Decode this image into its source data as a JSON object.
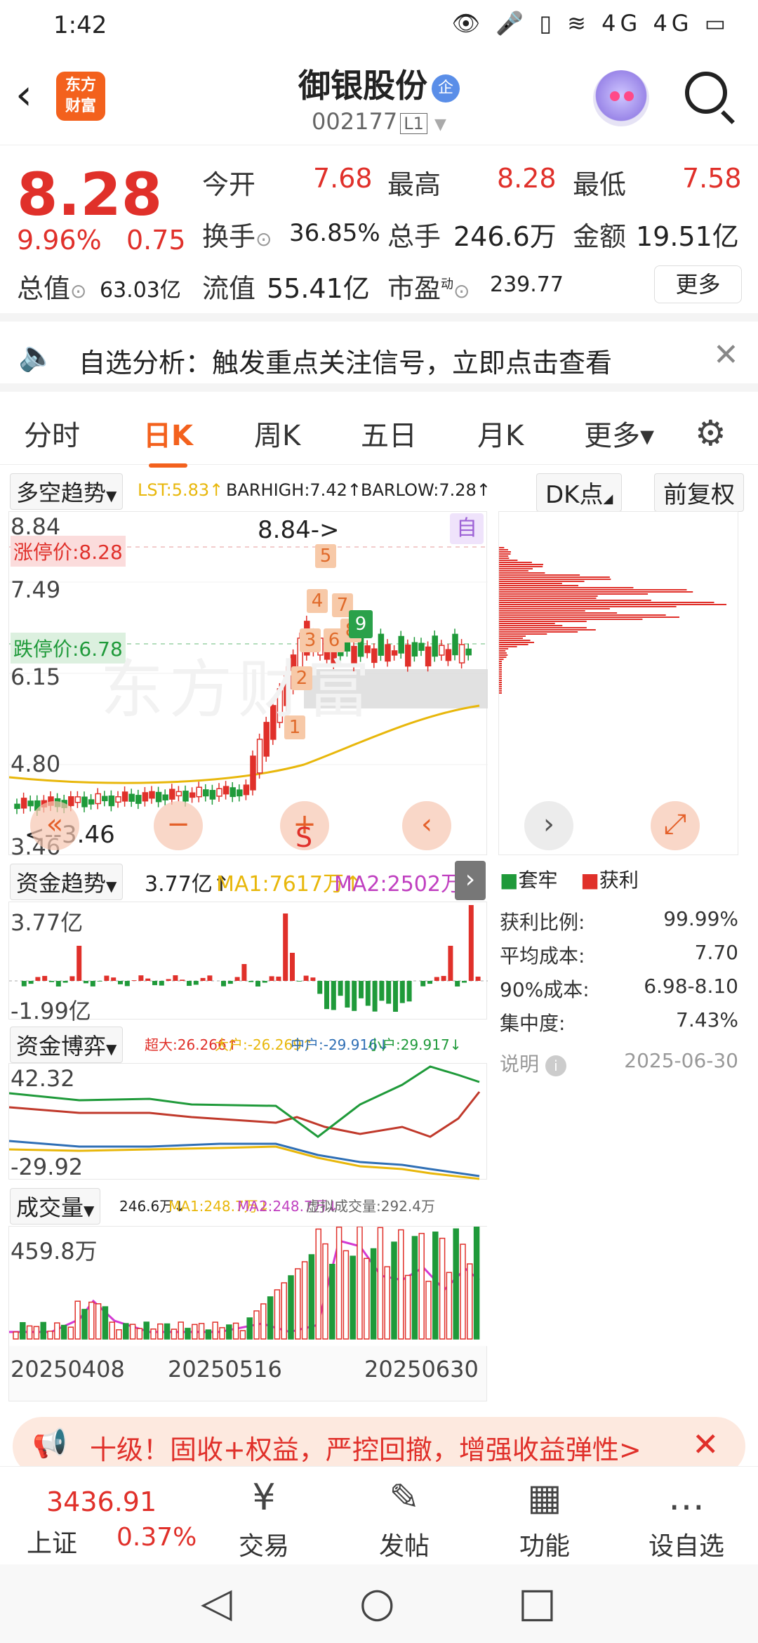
{
  "status_bar": {
    "time": "1:42",
    "icons": "👁 🎤 ▯ ≋ 4G 4G ▭"
  },
  "header": {
    "title": "御银股份",
    "qi_badge": "企",
    "code": "002177",
    "code_badge": "L1",
    "logo_text_1": "东方",
    "logo_text_2": "财富"
  },
  "quote": {
    "price": "8.28",
    "change_pct": "9.96%",
    "change_val": "0.75",
    "open_label": "今开",
    "open": "7.68",
    "high_label": "最高",
    "high": "8.28",
    "low_label": "最低",
    "low": "7.58",
    "turnover_label": "换手",
    "turnover": "36.85%",
    "volume_label": "总手",
    "volume": "246.6万",
    "amount_label": "金额",
    "amount": "19.51亿",
    "mcap_label": "总值",
    "mcap": "63.03亿",
    "float_label": "流值",
    "float": "55.41亿",
    "pe_label": "市盈",
    "pe_sup": "动",
    "pe": "239.77",
    "more": "更多"
  },
  "notice": {
    "text": "自选分析：触发重点关注信号，立即点击查看"
  },
  "tabs": [
    "分时",
    "日K",
    "周K",
    "五日",
    "月K",
    "更多▾"
  ],
  "kline": {
    "indicator": "多空趋势",
    "lst": "LST:5.83↑",
    "barhigh": "BARHIGH:7.42↑",
    "barlow": "BARLOW:7.28↑",
    "dk_btn": "DK点",
    "fq_btn": "前复权",
    "ticks": [
      "8.84",
      "7.49",
      "6.15",
      "4.80",
      "3.46"
    ],
    "limit_up": "涨停价:8.28",
    "limit_down": "跌停价:6.78",
    "high_mark": "8.84->",
    "low_mark": "<--3.46",
    "self_badge": "自",
    "watermark": "东方财富",
    "chips": [
      "1",
      "2",
      "3",
      "4",
      "5",
      "6",
      "7",
      "8",
      "9"
    ],
    "s_mark": "S"
  },
  "chip_dist": {
    "legend_trapped": "套牢",
    "legend_profit": "获利",
    "rows": [
      {
        "label": "获利比例:",
        "value": "99.99%"
      },
      {
        "label": "平均成本:",
        "value": "7.70"
      },
      {
        "label": "90%成本:",
        "value": "6.98-8.10"
      },
      {
        "label": "集中度:",
        "value": "7.43%"
      }
    ],
    "note": "说明",
    "date": "2025-06-30"
  },
  "fund_trend": {
    "indicator": "资金趋势",
    "val": "3.77亿↑",
    "ma1": "MA1:7617万↑",
    "ma2": "MA2:2502万↑",
    "top": "3.77亿",
    "bottom": "-1.99亿"
  },
  "fund_game": {
    "indicator": "资金博弈",
    "super": "超大:26.266↑",
    "big": "大户:-26.269↑",
    "mid": "中户:-29.916↓",
    "small": "小户:29.917↓",
    "top": "42.32",
    "bottom": "-29.92"
  },
  "vol": {
    "indicator": "成交量",
    "val": "246.6万↓",
    "ma1": "MA1:248.7万↓",
    "ma2": "MA2:248.7万↓",
    "virtual": "虚拟成交量:292.4万",
    "top": "459.8万",
    "dates": [
      "20250408",
      "20250516",
      "20250630"
    ]
  },
  "ad": {
    "text": "十级！固收+权益，严控回撤，增强收益弹性>"
  },
  "bottom_bar": {
    "index_value": "3436.91",
    "index_name": "上证",
    "index_pct": "0.37%",
    "items": [
      {
        "label": "交易",
        "icon": "¥"
      },
      {
        "label": "发帖",
        "icon": "✎"
      },
      {
        "label": "功能",
        "icon": "▦"
      },
      {
        "label": "设自选",
        "icon": "…"
      }
    ]
  },
  "colors": {
    "up": "#e0302a",
    "down": "#1f9a3a",
    "accent": "#f3611d"
  }
}
